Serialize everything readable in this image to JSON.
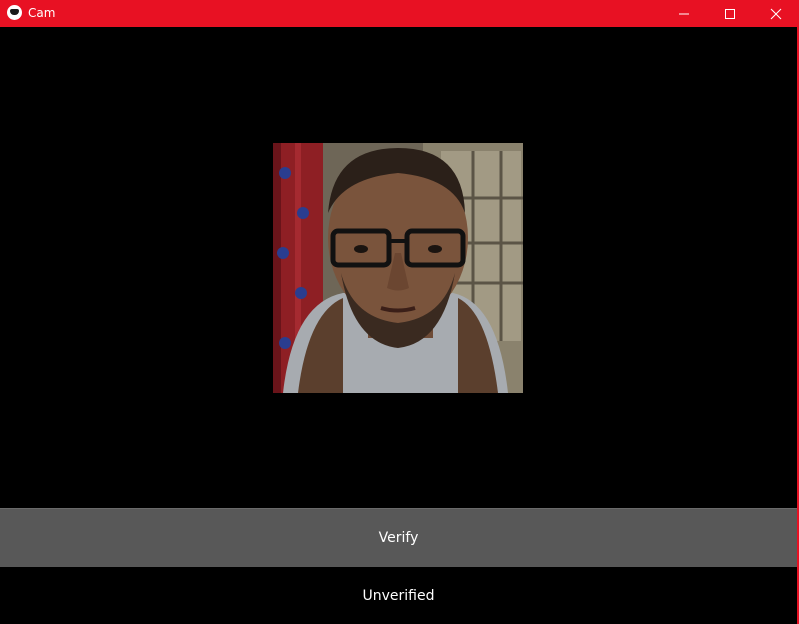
{
  "window": {
    "title": "Cam",
    "accent_color": "#e81123"
  },
  "controls": {
    "minimize_icon": "minimize-icon",
    "maximize_icon": "maximize-icon",
    "close_icon": "close-icon"
  },
  "camera": {
    "content": "live webcam feed"
  },
  "actions": {
    "verify_label": "Verify"
  },
  "status": {
    "text": "Unverified"
  }
}
